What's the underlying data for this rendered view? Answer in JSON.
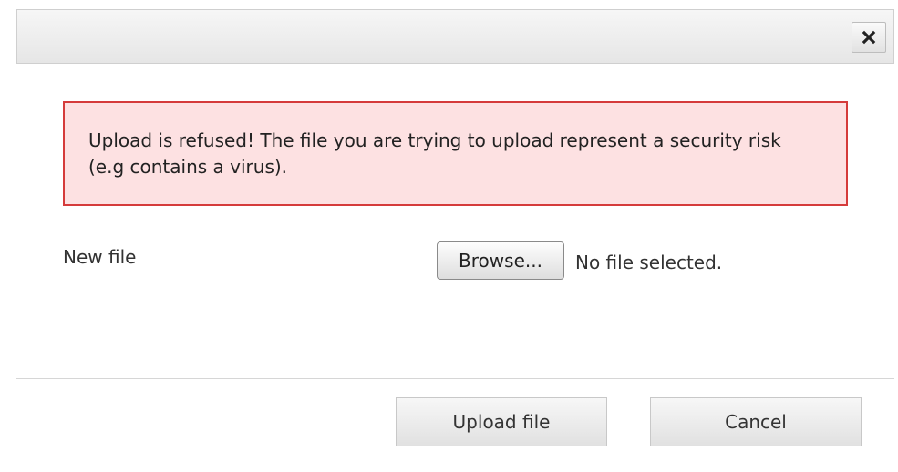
{
  "dialog": {
    "close_icon": "close-x-icon"
  },
  "error": {
    "message": "Upload is refused! The file you are trying to upload represent a security risk (e.g contains a virus)."
  },
  "form": {
    "new_file_label": "New file",
    "browse_label": "Browse...",
    "no_file_text": "No file selected."
  },
  "actions": {
    "upload_label": "Upload file",
    "cancel_label": "Cancel"
  },
  "colors": {
    "error_background": "#fde1e2",
    "error_border": "#d53b3b"
  }
}
